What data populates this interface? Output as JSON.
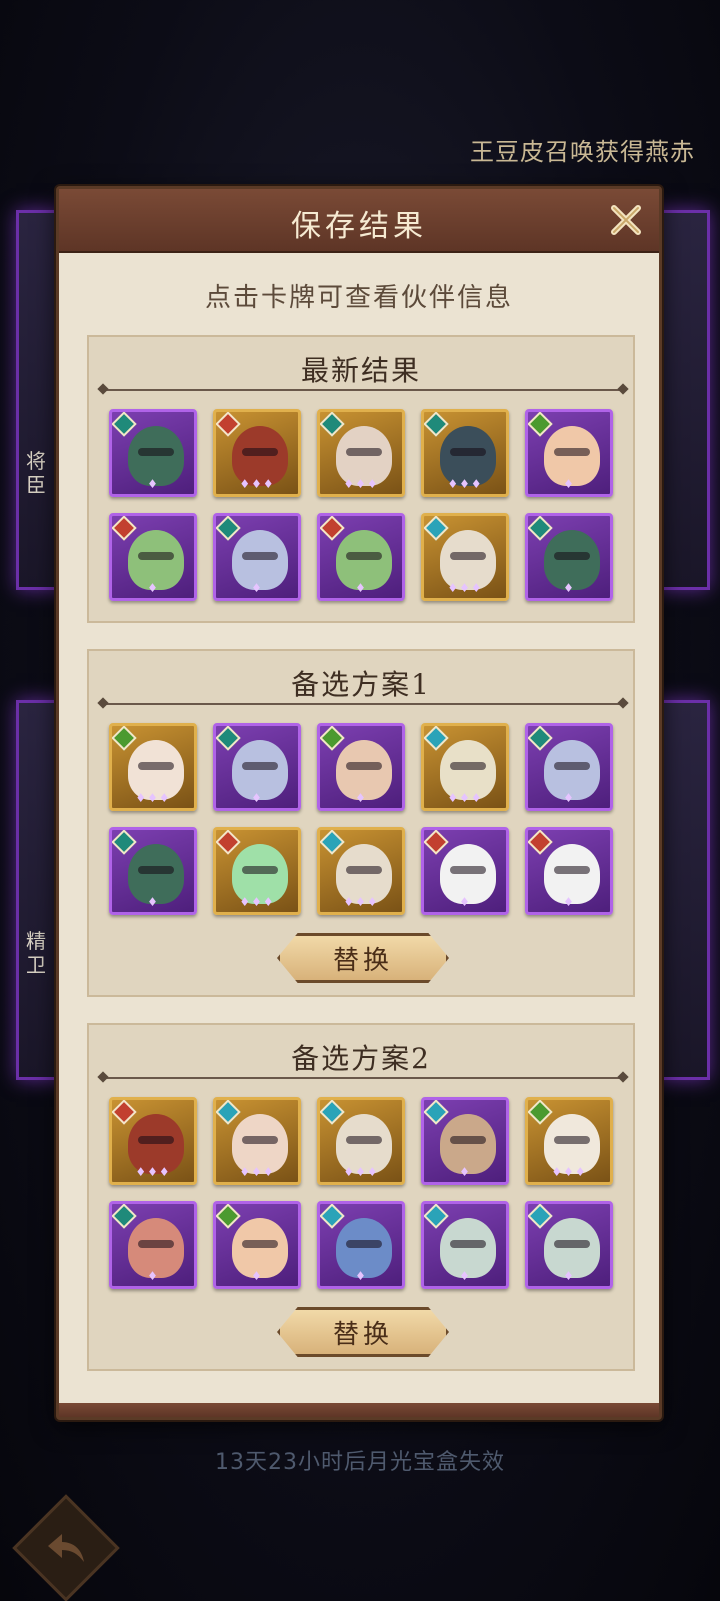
{
  "background": {
    "marquee_text": "王豆皮召唤获得燕赤",
    "left_labels": [
      "将臣",
      "精卫"
    ],
    "expire_note": "13天23小时后月光宝盒失效"
  },
  "dialog": {
    "title": "保存结果",
    "hint": "点击卡牌可查看伙伴信息",
    "sections": [
      {
        "title": "最新结果",
        "cards": [
          {
            "frame": "purple",
            "faction": "teal",
            "stars": "♦",
            "portrait": "#3f6d5a",
            "icon": "green-demon-portrait-icon"
          },
          {
            "frame": "gold",
            "faction": "red",
            "stars": "♦♦♦",
            "portrait": "#9c3a2a",
            "icon": "red-bird-warrior-portrait-icon"
          },
          {
            "frame": "gold",
            "faction": "teal",
            "stars": "♦♦♦",
            "portrait": "#e3d2c4",
            "icon": "dark-hair-woman-portrait-icon"
          },
          {
            "frame": "gold",
            "faction": "teal",
            "stars": "♦♦♦",
            "portrait": "#3b4e5a",
            "icon": "hatted-ghost-portrait-icon"
          },
          {
            "frame": "purple",
            "faction": "green",
            "stars": "♦",
            "portrait": "#f0c8a8",
            "icon": "bald-monk-portrait-icon"
          },
          {
            "frame": "purple",
            "faction": "red",
            "stars": "♦",
            "portrait": "#8ec07a",
            "icon": "flower-fairy-portrait-icon"
          },
          {
            "frame": "purple",
            "faction": "teal",
            "stars": "♦",
            "portrait": "#b8c0e0",
            "icon": "pale-ghost-girl-portrait-icon"
          },
          {
            "frame": "purple",
            "faction": "red",
            "stars": "♦",
            "portrait": "#8ec07a",
            "icon": "flower-fairy-portrait-icon"
          },
          {
            "frame": "gold",
            "faction": "sky",
            "stars": "♦♦♦",
            "portrait": "#e6dccc",
            "icon": "black-hair-man-portrait-icon"
          },
          {
            "frame": "purple",
            "faction": "teal",
            "stars": "♦",
            "portrait": "#3f6d5a",
            "icon": "green-demon-portrait-icon"
          }
        ]
      },
      {
        "title": "备选方案1",
        "replace_label": "替换",
        "cards": [
          {
            "frame": "gold",
            "faction": "green",
            "stars": "♦♦♦",
            "portrait": "#f1e2d6",
            "icon": "flower-girl-portrait-icon"
          },
          {
            "frame": "purple",
            "faction": "teal",
            "stars": "♦",
            "portrait": "#b8c0e0",
            "icon": "pale-ghost-girl-portrait-icon"
          },
          {
            "frame": "purple",
            "faction": "green",
            "stars": "♦",
            "portrait": "#e8c8b0",
            "icon": "horned-girl-portrait-icon"
          },
          {
            "frame": "gold",
            "faction": "sky",
            "stars": "♦♦♦",
            "portrait": "#e8e0c8",
            "icon": "white-hair-man-portrait-icon"
          },
          {
            "frame": "purple",
            "faction": "teal",
            "stars": "♦",
            "portrait": "#b8c0e0",
            "icon": "pale-ghost-girl-portrait-icon"
          },
          {
            "frame": "purple",
            "faction": "teal",
            "stars": "♦",
            "portrait": "#3f6d5a",
            "icon": "green-demon-portrait-icon"
          },
          {
            "frame": "gold",
            "faction": "red",
            "stars": "♦♦♦",
            "portrait": "#9fe0a8",
            "icon": "green-hair-fairy-portrait-icon"
          },
          {
            "frame": "gold",
            "faction": "sky",
            "stars": "♦♦♦",
            "portrait": "#e6dccc",
            "icon": "black-hair-man-portrait-icon"
          },
          {
            "frame": "purple",
            "faction": "red",
            "stars": "♦",
            "portrait": "#f2f2f2",
            "icon": "white-rabbit-portrait-icon"
          },
          {
            "frame": "purple",
            "faction": "red",
            "stars": "♦",
            "portrait": "#f2f2f2",
            "icon": "white-rabbit-portrait-icon"
          }
        ]
      },
      {
        "title": "备选方案2",
        "replace_label": "替换",
        "cards": [
          {
            "frame": "gold",
            "faction": "red",
            "stars": "♦♦♦",
            "portrait": "#9c3a2a",
            "icon": "red-bird-warrior-portrait-icon"
          },
          {
            "frame": "gold",
            "faction": "sky",
            "stars": "♦♦♦",
            "portrait": "#eed6c6",
            "icon": "laughing-woman-portrait-icon"
          },
          {
            "frame": "gold",
            "faction": "sky",
            "stars": "♦♦♦",
            "portrait": "#e6dccc",
            "icon": "black-hair-man-portrait-icon"
          },
          {
            "frame": "purple",
            "faction": "sky",
            "stars": "♦",
            "portrait": "#caa88a",
            "icon": "bearded-general-portrait-icon"
          },
          {
            "frame": "gold",
            "faction": "green",
            "stars": "♦♦♦",
            "portrait": "#f0e8dc",
            "icon": "old-sage-portrait-icon"
          },
          {
            "frame": "purple",
            "faction": "teal",
            "stars": "♦",
            "portrait": "#d68a7a",
            "icon": "pig-monster-portrait-icon"
          },
          {
            "frame": "purple",
            "faction": "green",
            "stars": "♦",
            "portrait": "#f0c8a8",
            "icon": "bald-monk-portrait-icon"
          },
          {
            "frame": "purple",
            "faction": "sky",
            "stars": "♦",
            "portrait": "#6c8cc8",
            "icon": "blue-hair-demon-portrait-icon"
          },
          {
            "frame": "purple",
            "faction": "sky",
            "stars": "♦",
            "portrait": "#c8d8d0",
            "icon": "pale-elf-portrait-icon"
          },
          {
            "frame": "purple",
            "faction": "sky",
            "stars": "♦",
            "portrait": "#c8d8d0",
            "icon": "pale-elf-portrait-icon"
          }
        ]
      }
    ]
  },
  "colors": {
    "dialog_bg": "#ebe3d2",
    "header_bg": "#6b3f2e",
    "frame_purple": "#b063e8",
    "frame_gold": "#e0b04c"
  }
}
